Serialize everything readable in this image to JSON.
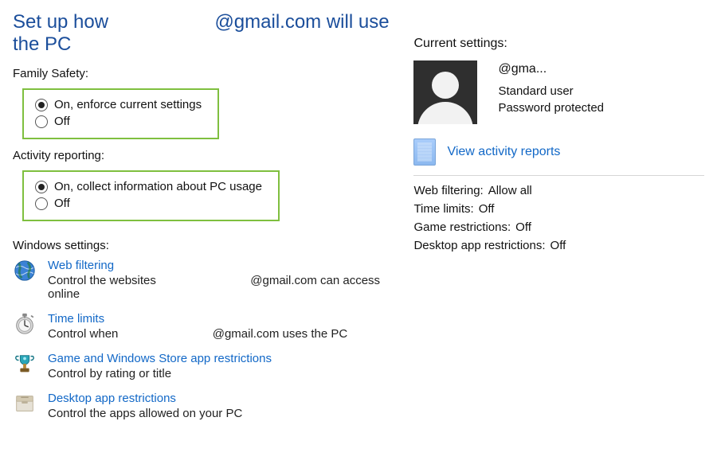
{
  "title_prefix": "Set up how",
  "title_email": "@gmail.com",
  "title_suffix": "will use the PC",
  "family_safety_label": "Family Safety:",
  "family_safety_on": "On, enforce current settings",
  "family_safety_off": "Off",
  "activity_reporting_label": "Activity reporting:",
  "activity_reporting_on": "On, collect information about PC usage",
  "activity_reporting_off": "Off",
  "windows_settings_label": "Windows settings:",
  "web_filtering_link": "Web filtering",
  "web_filtering_desc_a": "Control the websites",
  "web_filtering_desc_email": "@gmail.com",
  "web_filtering_desc_b": "can access online",
  "time_limits_link": "Time limits",
  "time_limits_desc_a": "Control when",
  "time_limits_desc_email": "@gmail.com",
  "time_limits_desc_b": "uses the PC",
  "game_restrictions_link": "Game and Windows Store app restrictions",
  "game_restrictions_desc": "Control by rating or title",
  "desktop_restrictions_link": "Desktop app restrictions",
  "desktop_restrictions_desc": "Control the apps allowed on your PC",
  "current_settings_label": "Current settings:",
  "account_email": "@gma...",
  "account_type": "Standard user",
  "account_protection": "Password protected",
  "activity_reports_link": "View activity reports",
  "summary": {
    "web_filtering_k": "Web filtering:",
    "web_filtering_v": "Allow all",
    "time_limits_k": "Time limits:",
    "time_limits_v": "Off",
    "game_restrictions_k": "Game restrictions:",
    "game_restrictions_v": "Off",
    "desktop_restrictions_k": "Desktop app restrictions:",
    "desktop_restrictions_v": "Off"
  }
}
